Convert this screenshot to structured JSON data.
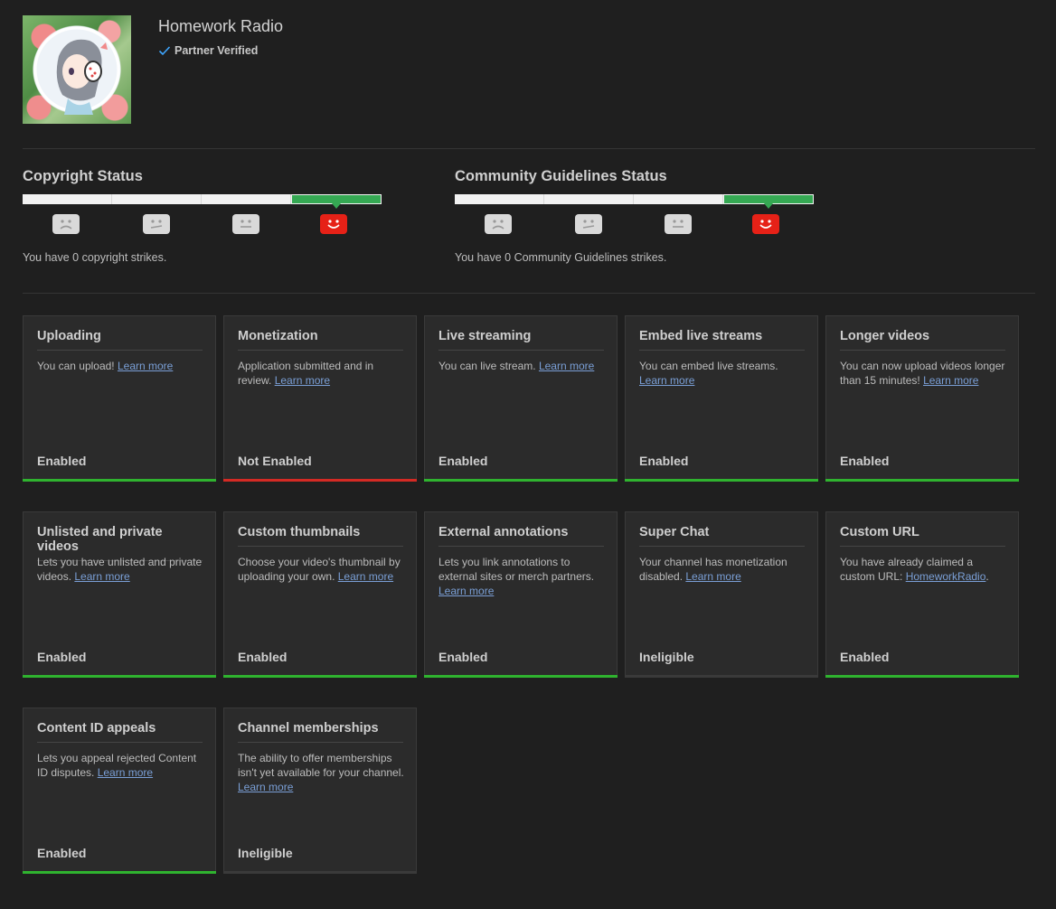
{
  "channel": {
    "name": "Homework Radio",
    "verified_label": "Partner Verified"
  },
  "copyright": {
    "title": "Copyright Status",
    "strikes_text": "You have 0 copyright strikes."
  },
  "community": {
    "title": "Community Guidelines Status",
    "strikes_text": "You have 0 Community Guidelines strikes."
  },
  "colors": {
    "enabled": "#2fb32f",
    "not_enabled": "#d42a24",
    "ineligible": "#3a3a3a"
  },
  "features": [
    {
      "title": "Uploading",
      "desc": "You can upload! ",
      "link": "Learn more",
      "after": "",
      "state": "Enabled",
      "status": "enabled"
    },
    {
      "title": "Monetization",
      "desc": "Application submitted and in review. ",
      "link": "Learn more",
      "after": "",
      "state": "Not Enabled",
      "status": "not_enabled"
    },
    {
      "title": "Live streaming",
      "desc": "You can live stream. ",
      "link": "Learn more",
      "after": "",
      "state": "Enabled",
      "status": "enabled"
    },
    {
      "title": "Embed live streams",
      "desc": "You can embed live streams. ",
      "link": "Learn more",
      "after": "",
      "state": "Enabled",
      "status": "enabled"
    },
    {
      "title": "Longer videos",
      "desc": "You can now upload videos longer than 15 minutes! ",
      "link": "Learn more",
      "after": "",
      "state": "Enabled",
      "status": "enabled"
    },
    {
      "title": "Unlisted and private videos",
      "desc": "Lets you have unlisted and private videos. ",
      "link": "Learn more",
      "after": "",
      "state": "Enabled",
      "status": "enabled"
    },
    {
      "title": "Custom thumbnails",
      "desc": "Choose your video's thumbnail by uploading your own. ",
      "link": "Learn more",
      "after": "",
      "state": "Enabled",
      "status": "enabled"
    },
    {
      "title": "External annotations",
      "desc": "Lets you link annotations to external sites or merch partners. ",
      "link": "Learn more",
      "after": "",
      "state": "Enabled",
      "status": "enabled"
    },
    {
      "title": "Super Chat",
      "desc": "Your channel has monetization disabled. ",
      "link": "Learn more",
      "after": "",
      "state": "Ineligible",
      "status": "ineligible"
    },
    {
      "title": "Custom URL",
      "desc": "You have already claimed a custom URL: ",
      "link": "HomeworkRadio",
      "after": ".",
      "state": "Enabled",
      "status": "enabled"
    },
    {
      "title": "Content ID appeals",
      "desc": "Lets you appeal rejected Content ID disputes. ",
      "link": "Learn more",
      "after": "",
      "state": "Enabled",
      "status": "enabled"
    },
    {
      "title": "Channel memberships",
      "desc": "The ability to offer memberships isn't yet available for your channel. ",
      "link": "Learn more",
      "after": "",
      "state": "Ineligible",
      "status": "ineligible"
    }
  ]
}
